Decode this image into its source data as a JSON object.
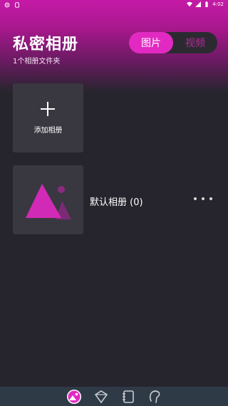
{
  "status_bar": {
    "time": "4:02",
    "left_icons": [
      "gear-icon",
      "sim-icon"
    ],
    "right_icons": [
      "wifi-icon",
      "signal-icon",
      "battery-icon"
    ]
  },
  "header": {
    "title": "私密相册",
    "subtitle": "1个相册文件夹"
  },
  "tabs": [
    {
      "label": "图片",
      "active": true
    },
    {
      "label": "视频",
      "active": false
    }
  ],
  "add_album": {
    "label": "添加相册",
    "icon": "plus-icon"
  },
  "albums": [
    {
      "name": "默认相册 (0)",
      "icon": "image-placeholder-icon",
      "menu_icon": "more-dots-icon"
    }
  ],
  "bottom_nav": [
    {
      "icon": "album-nav-icon",
      "active": true
    },
    {
      "icon": "diamond-nav-icon",
      "active": false
    },
    {
      "icon": "notebook-nav-icon",
      "active": false
    },
    {
      "icon": "chat-bubble-nav-icon",
      "active": false
    }
  ],
  "colors": {
    "accent": "#e22ac2",
    "background": "#26252d",
    "card": "#393841",
    "nav": "#2f3a47"
  }
}
